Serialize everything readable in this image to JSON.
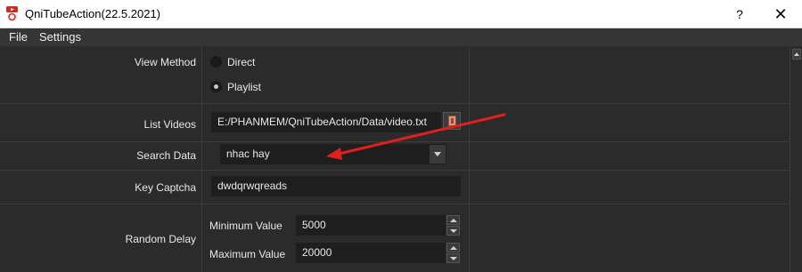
{
  "window": {
    "title": "QniTubeAction(22.5.2021)",
    "help_label": "?",
    "close_label": "✕"
  },
  "menu": {
    "items": [
      "File",
      "Settings"
    ]
  },
  "form": {
    "view_method": {
      "label": "View Method",
      "options": [
        "Direct",
        "Playlist"
      ],
      "selected": "Playlist"
    },
    "list_videos": {
      "label": "List Videos",
      "value": "E:/PHANMEM/QniTubeAction/Data/video.txt"
    },
    "search_data": {
      "label": "Search Data",
      "value": "nhac hay"
    },
    "key_captcha": {
      "label": "Key Captcha",
      "value": "dwdqrwqreads"
    },
    "random_delay": {
      "label": "Random Delay",
      "min_label": "Minimum Value",
      "min_value": "5000",
      "max_label": "Maximum Value",
      "max_value": "20000"
    }
  },
  "colors": {
    "background": "#2b2b2b",
    "input_background": "#1e1e1e",
    "annotation_arrow": "#e02020"
  },
  "icons": {
    "app": "youtube-logo-icon",
    "browse": "file-browse-icon",
    "combo": "chevron-down-icon",
    "spin_up": "triangle-up-icon",
    "spin_down": "triangle-down-icon"
  }
}
